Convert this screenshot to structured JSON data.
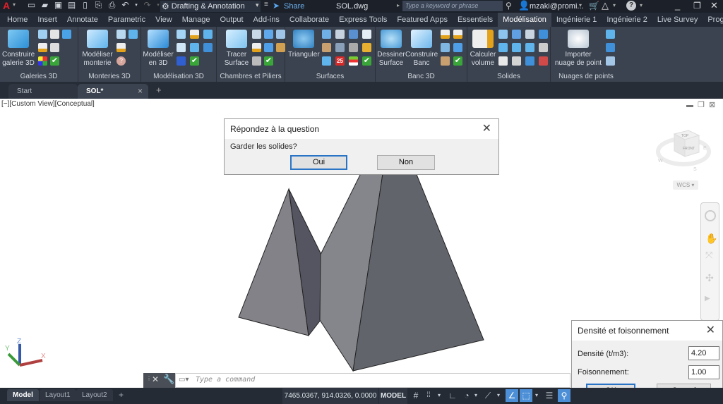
{
  "app": {
    "logo_label": "A",
    "workspace": "Drafting & Annotation",
    "share_label": "Share",
    "document_title": "SOL.dwg",
    "search_placeholder": "Type a keyword or phrase",
    "user": "mzaki@promi...",
    "help_label": "?"
  },
  "menu_tabs": [
    {
      "label": "Home"
    },
    {
      "label": "Insert"
    },
    {
      "label": "Annotate"
    },
    {
      "label": "Parametric"
    },
    {
      "label": "View"
    },
    {
      "label": "Manage"
    },
    {
      "label": "Output"
    },
    {
      "label": "Add-ins"
    },
    {
      "label": "Collaborate"
    },
    {
      "label": "Express Tools"
    },
    {
      "label": "Featured Apps"
    },
    {
      "label": "Essentiels"
    },
    {
      "label": "Modélisation",
      "active": true
    },
    {
      "label": "Ingénierie 1"
    },
    {
      "label": "Ingénierie 2"
    },
    {
      "label": "Live Survey"
    },
    {
      "label": "Progeox"
    }
  ],
  "ribbon": {
    "panels": [
      {
        "title": "Galeries 3D",
        "big_button": [
          "Construire",
          "galerie 3D"
        ]
      },
      {
        "title": "Monteries 3D",
        "big_button": [
          "Modéliser",
          "monterie"
        ]
      },
      {
        "title": "Modélisation 3D",
        "big_button": [
          "Modéliser",
          "en 3D"
        ]
      },
      {
        "title": "Chambres et Piliers",
        "big_button": [
          "Tracer",
          "Surface"
        ]
      },
      {
        "title": "Surfaces",
        "big_button": [
          "Trianguler",
          ""
        ]
      },
      {
        "title": "Banc 3D",
        "big_button": [
          "Dessiner",
          "Surface"
        ],
        "big_button2": [
          "Construire",
          "Banc"
        ]
      },
      {
        "title": "Solides",
        "big_button": [
          "Calculer",
          "volume"
        ]
      },
      {
        "title": "Nuages de points",
        "big_button": [
          "Importer",
          "nuage de point"
        ]
      }
    ]
  },
  "doc_tabs": {
    "start": "Start",
    "active": "SOL*",
    "close": "×",
    "add": "+"
  },
  "viewport": {
    "label": "[−][Custom View][Conceptual]",
    "viewcube": {
      "top": "TOP",
      "front": "FRONT",
      "east": "E",
      "west": "W",
      "south": "S",
      "wcs": "WCS"
    },
    "ucs": {
      "x": "X",
      "y": "Y",
      "z": "Z"
    }
  },
  "question_dialog": {
    "title": "Répondez à la question",
    "message": "Garder les solides?",
    "yes_label": "Oui",
    "no_label": "Non"
  },
  "density_dialog": {
    "title": "Densité et foisonnement",
    "density_label": "Densité (t/m3):",
    "density_value": "4.20",
    "swell_label": "Foisonnement:",
    "swell_value": "1.00",
    "ok_label": "OK",
    "cancel_label": "Cancel"
  },
  "command_line": {
    "placeholder": "Type a command"
  },
  "status_bar": {
    "layouts": [
      "Model",
      "Layout1",
      "Layout2"
    ],
    "add_layout": "+",
    "coordinates": "7465.0367, 914.0326, 0.0000",
    "space": "MODEL"
  },
  "colors": {
    "accent": "#2a74c6",
    "ribbon_bg": "#3b4350",
    "title_bg": "#1b2029"
  }
}
